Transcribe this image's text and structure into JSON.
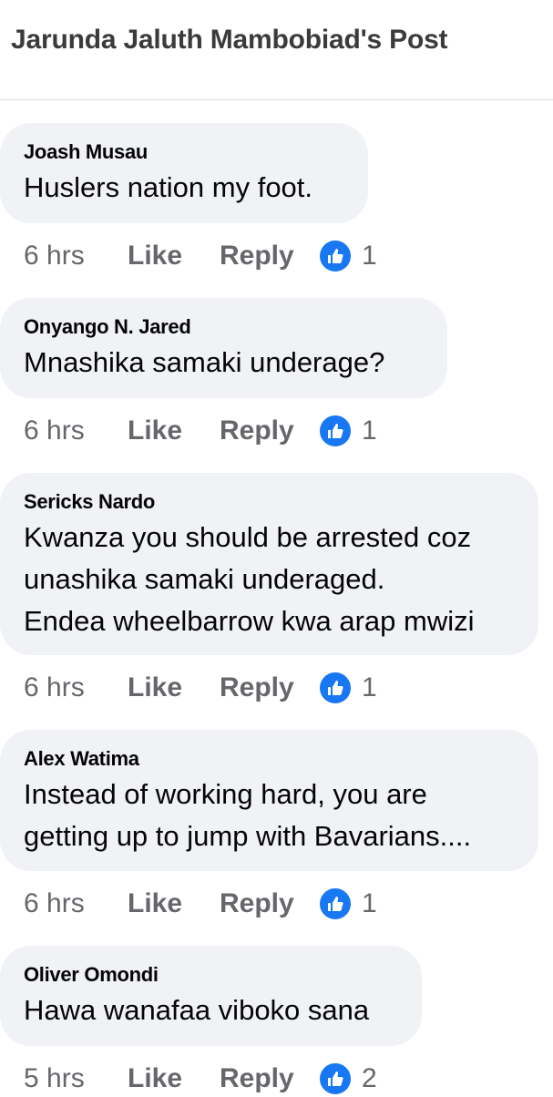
{
  "header": {
    "title": "Jarunda Jaluth Mambobiad's Post"
  },
  "comments": [
    {
      "author": "Joash Musau",
      "text": "Huslers nation my foot.",
      "time": "6 hrs",
      "like": "Like",
      "reply": "Reply",
      "reactions": "1"
    },
    {
      "author": "Onyango N. Jared",
      "text": "Mnashika samaki underage?",
      "time": "6 hrs",
      "like": "Like",
      "reply": "Reply",
      "reactions": "1"
    },
    {
      "author": "Sericks Nardo",
      "text": "Kwanza you should be arrested coz\nunashika samaki underaged.\nEndea wheelbarrow kwa arap mwizi",
      "time": "6 hrs",
      "like": "Like",
      "reply": "Reply",
      "reactions": "1"
    },
    {
      "author": "Alex Watima",
      "text": "Instead of working hard, you are\ngetting up to jump with Bavarians....",
      "time": "6 hrs",
      "like": "Like",
      "reply": "Reply",
      "reactions": "1"
    },
    {
      "author": "Oliver Omondi",
      "text": "Hawa wanafaa viboko sana",
      "time": "5 hrs",
      "like": "Like",
      "reply": "Reply",
      "reactions": "2"
    }
  ],
  "colors": {
    "bubble": "#f0f2f5",
    "meta": "#65676b",
    "like_blue": "#1877f2"
  },
  "icons": {
    "reaction": "thumbs-up-icon"
  }
}
